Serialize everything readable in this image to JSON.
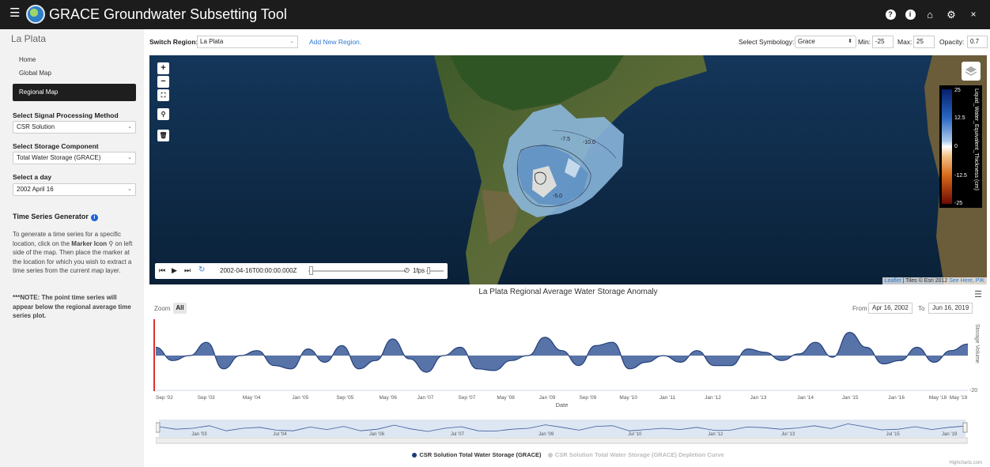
{
  "app": {
    "title": "GRACE Groundwater Subsetting Tool"
  },
  "topbar": {
    "icons": [
      "help-icon",
      "info-icon",
      "home-icon",
      "gear-icon",
      "close-icon"
    ]
  },
  "sidebar": {
    "region": "La Plata",
    "nav": [
      {
        "label": "Home"
      },
      {
        "label": "Global Map"
      },
      {
        "label": "Regional Map"
      }
    ],
    "method_label": "Select Signal Processing Method",
    "method_value": "CSR Solution",
    "storage_label": "Select Storage Component",
    "storage_value": "Total Water Storage (GRACE)",
    "day_label": "Select a day",
    "day_value": "2002 April 16",
    "tsg_title": "Time Series Generator",
    "tsg_text_1": "To generate a time series for a specific location, click on the",
    "tsg_marker": "Marker Icon",
    "tsg_text_2": "on left side of the map. Then place the marker at the location for which you wish to extract a time series from the current map layer.",
    "tsg_note": "***NOTE: The point time series will appear below the regional average time series plot."
  },
  "controls": {
    "switch_label": "Switch Region:",
    "switch_value": "La Plata",
    "add_region": "Add New Region.",
    "symbology_label": "Select Symbology:",
    "symbology_value": "Grace",
    "min_label": "Min:",
    "min_value": "-25",
    "max_label": "Max:",
    "max_value": "25",
    "opacity_label": "Opacity:",
    "opacity_value": "0.7"
  },
  "map": {
    "legend_ticks": [
      "25",
      "12.5",
      "0",
      "-12.5",
      "-25"
    ],
    "legend_title": "Liquid_Water_Equivalent_Thickness (cm)",
    "time_value": "2002-04-16T00:00:00.000Z",
    "fps": "1fps",
    "contours": [
      "-7.5",
      "-10.0",
      "-5.0"
    ],
    "attribution_leaflet": "Leaflet",
    "attribution_tiles": " | Tiles © Esri 2012 ",
    "attribution_link": "See Here, PIK"
  },
  "chart": {
    "title": "La Plata Regional Average Water Storage Anomaly",
    "zoom_label": "Zoom",
    "zoom_all": "All",
    "from_label": "From",
    "from_value": "Apr 16, 2002",
    "to_label": "To",
    "to_value": "Jun 16, 2019",
    "xlabel": "Date",
    "ylabel": "Storage Volume",
    "ymin_label": "-20",
    "legend_1": "CSR Solution Total Water Storage (GRACE)",
    "legend_2": "CSR Solution Total Water Storage (GRACE) Depletion Curve",
    "credits": "Highcharts.com",
    "navigator_labels": [
      "Jan '03",
      "Jul '04",
      "Jan '06",
      "Jul '07",
      "Jan '09",
      "Jul '10",
      "Jan '12",
      "Jul '13",
      "Jul '15",
      "Jan '19"
    ]
  },
  "chart_data": {
    "type": "area",
    "title": "La Plata Regional Average Water Storage Anomaly",
    "xlabel": "Date",
    "ylabel": "Storage Volume",
    "series_color": "#3a5a99",
    "x_ticks": [
      "Sep '02",
      "Sep '03",
      "May '04",
      "Jan '05",
      "Sep '05",
      "May '06",
      "Jan '07",
      "Sep '07",
      "May '08",
      "Jan '09",
      "Sep '09",
      "May '10",
      "Jan '11",
      "Jan '12",
      "Jan '13",
      "Jan '14",
      "Jan '15",
      "Jan '16",
      "May '18",
      "May '19"
    ],
    "x": [
      "2002-04",
      "2002-09",
      "2003-01",
      "2003-05",
      "2003-09",
      "2004-01",
      "2004-05",
      "2004-09",
      "2005-01",
      "2005-05",
      "2005-09",
      "2006-01",
      "2006-05",
      "2006-09",
      "2007-01",
      "2007-05",
      "2007-09",
      "2008-01",
      "2008-05",
      "2008-09",
      "2009-01",
      "2009-05",
      "2009-09",
      "2010-01",
      "2010-05",
      "2010-09",
      "2011-01",
      "2011-05",
      "2011-09",
      "2012-01",
      "2012-05",
      "2012-09",
      "2013-01",
      "2013-05",
      "2013-09",
      "2014-01",
      "2014-05",
      "2014-09",
      "2015-01",
      "2015-05",
      "2015-09",
      "2016-01",
      "2016-05",
      "2016-09",
      "2017-06",
      "2017-12",
      "2018-05",
      "2018-11",
      "2019-06"
    ],
    "values": [
      5,
      -3,
      0,
      8,
      -8,
      0,
      3,
      -6,
      -8,
      4,
      -4,
      6,
      -8,
      -3,
      10,
      -2,
      -10,
      0,
      5,
      -8,
      -9,
      -3,
      0,
      11,
      3,
      -6,
      6,
      8,
      -8,
      -4,
      0,
      -4,
      3,
      -6,
      -6,
      4,
      2,
      -3,
      1,
      8,
      -1,
      14,
      5,
      -5,
      -3,
      5,
      -4,
      3,
      7
    ],
    "ylim": [
      -20,
      20
    ]
  }
}
